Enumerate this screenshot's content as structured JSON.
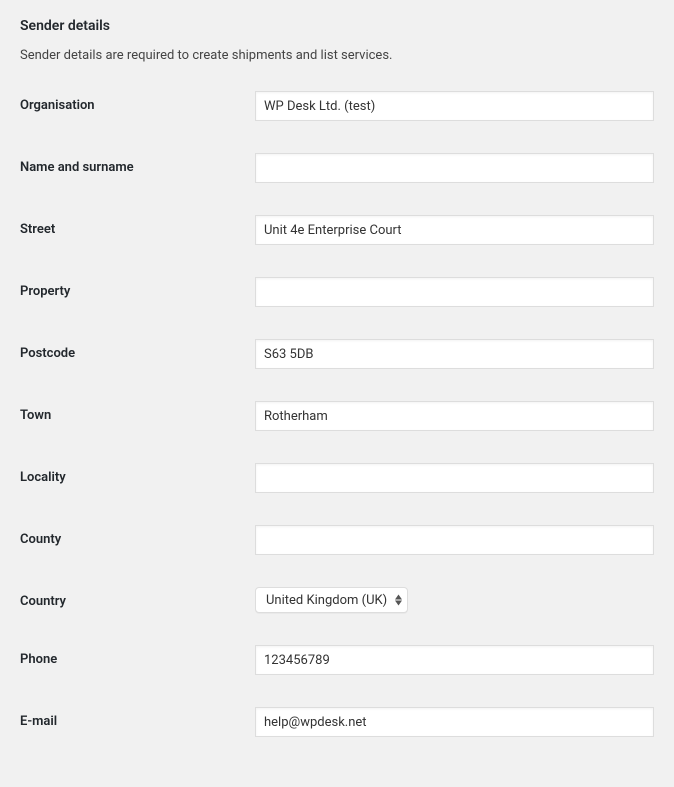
{
  "section": {
    "heading": "Sender details",
    "description": "Sender details are required to create shipments and list services."
  },
  "fields": {
    "organisation": {
      "label": "Organisation",
      "value": "WP Desk Ltd. (test)"
    },
    "name_surname": {
      "label": "Name and surname",
      "value": ""
    },
    "street": {
      "label": "Street",
      "value": "Unit 4e Enterprise Court"
    },
    "property": {
      "label": "Property",
      "value": ""
    },
    "postcode": {
      "label": "Postcode",
      "value": "S63 5DB"
    },
    "town": {
      "label": "Town",
      "value": "Rotherham"
    },
    "locality": {
      "label": "Locality",
      "value": ""
    },
    "county": {
      "label": "County",
      "value": ""
    },
    "country": {
      "label": "Country",
      "selected": "United Kingdom (UK)"
    },
    "phone": {
      "label": "Phone",
      "value": "123456789"
    },
    "email": {
      "label": "E-mail",
      "value": "help@wpdesk.net"
    }
  }
}
